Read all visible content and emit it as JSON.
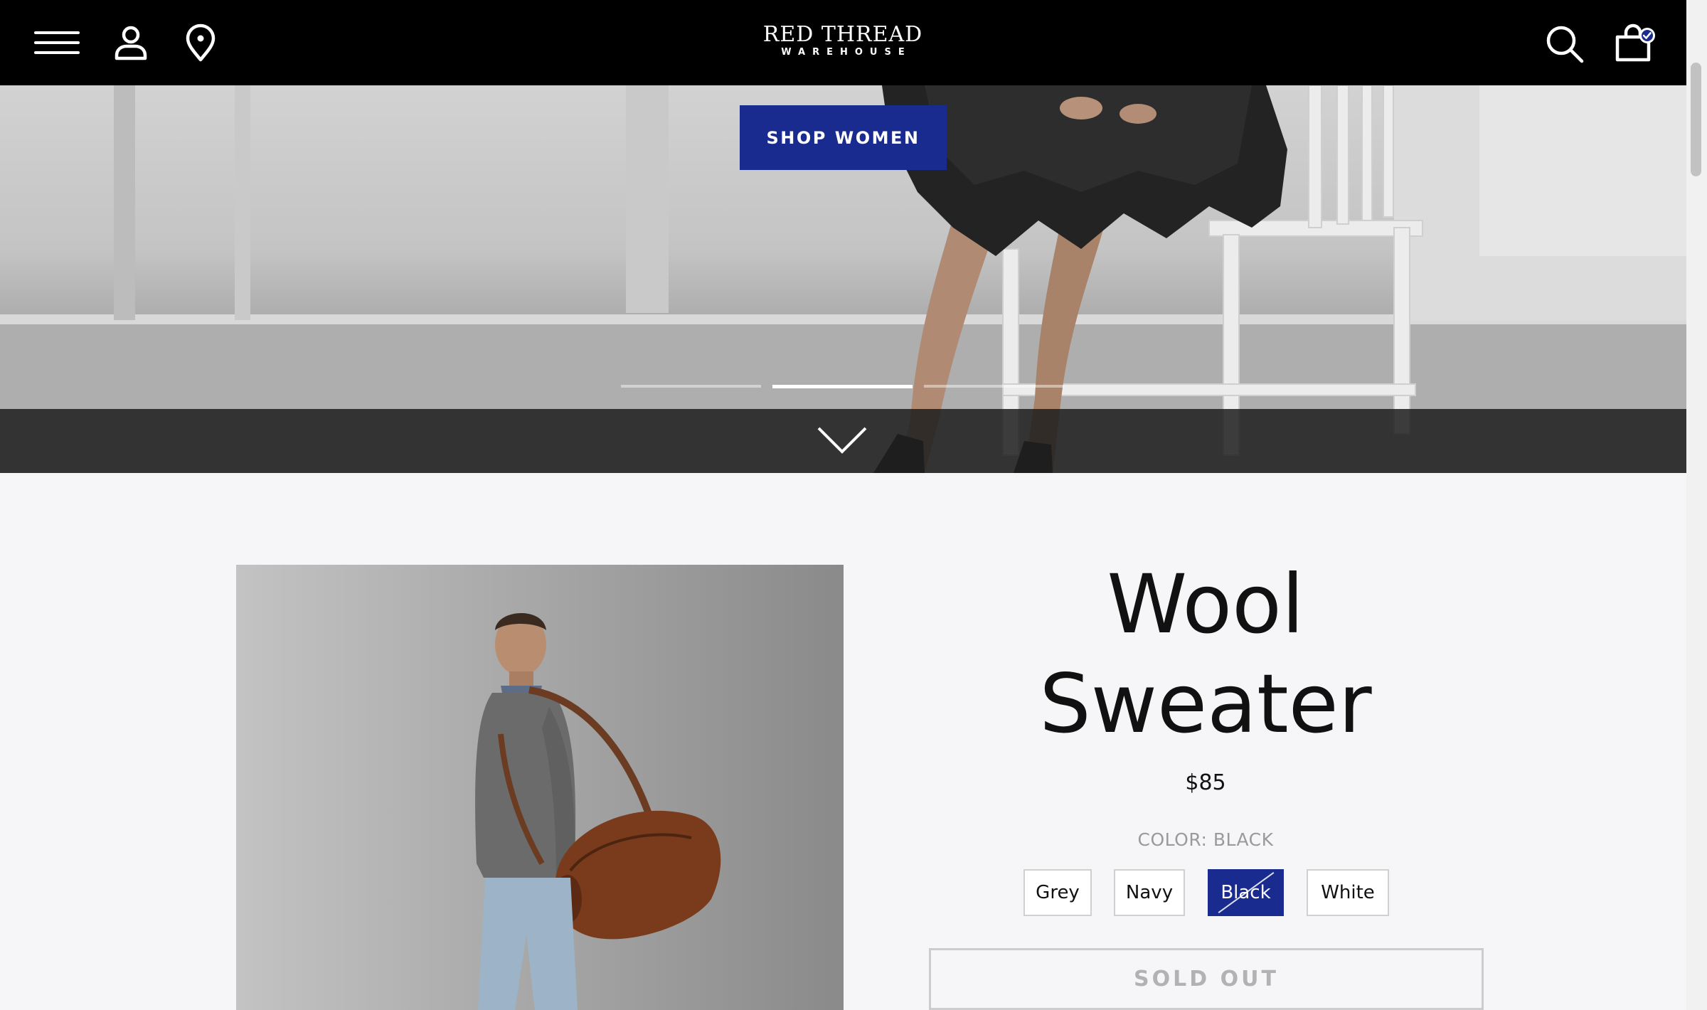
{
  "header": {
    "logo_main": "RED THREAD",
    "logo_sub": "WAREHOUSE",
    "icons": [
      "menu-icon",
      "account-icon",
      "location-pin-icon",
      "search-icon",
      "shopping-bag-icon"
    ]
  },
  "hero": {
    "cta_label": "SHOP WOMEN",
    "slides": 3,
    "active_slide": 2,
    "scroll_icon": "chevron-down-icon"
  },
  "product": {
    "title_line1": "Wool",
    "title_line2": "Sweater",
    "price": "$85",
    "color_label": "COLOR: BLACK",
    "colors": [
      "Grey",
      "Navy",
      "Black",
      "White"
    ],
    "selected_color": "Black",
    "cta_label": "SOLD OUT"
  },
  "colors": {
    "header_bg": "#000000",
    "accent": "#1a2b8f",
    "page_bg": "#f6f6f8",
    "muted_text": "#9a9a9a"
  }
}
